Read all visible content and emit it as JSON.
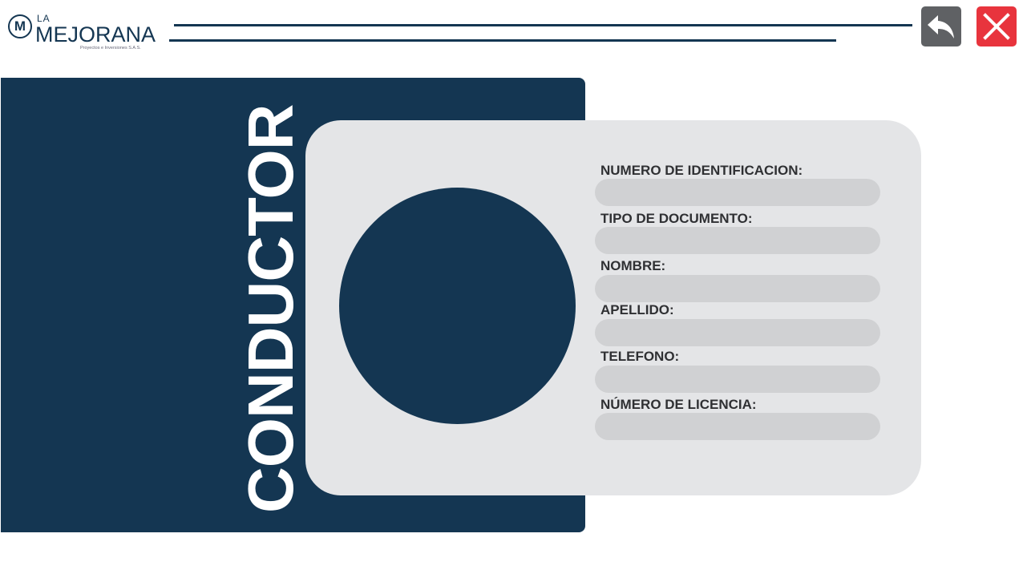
{
  "logo": {
    "mark": "M",
    "la": "LA",
    "name": "MEJORANA",
    "subtitle": "Proyectos e Inversiones S.A.S."
  },
  "toolbar": {
    "back_icon": "back-arrow-icon",
    "close_icon": "close-icon"
  },
  "page": {
    "title": "CONDUCTOR"
  },
  "form": {
    "fields": [
      {
        "label": "NUMERO DE IDENTIFICACION:",
        "value": ""
      },
      {
        "label": "TIPO DE DOCUMENTO:",
        "value": ""
      },
      {
        "label": "NOMBRE:",
        "value": ""
      },
      {
        "label": "APELLIDO:",
        "value": ""
      },
      {
        "label": "TELEFONO:",
        "value": ""
      },
      {
        "label": "NÚMERO DE LICENCIA:",
        "value": ""
      }
    ]
  },
  "colors": {
    "primary": "#143652",
    "card": "#e4e5e7",
    "input": "#d0d1d3",
    "close": "#e8343d",
    "back": "#5f6164"
  }
}
